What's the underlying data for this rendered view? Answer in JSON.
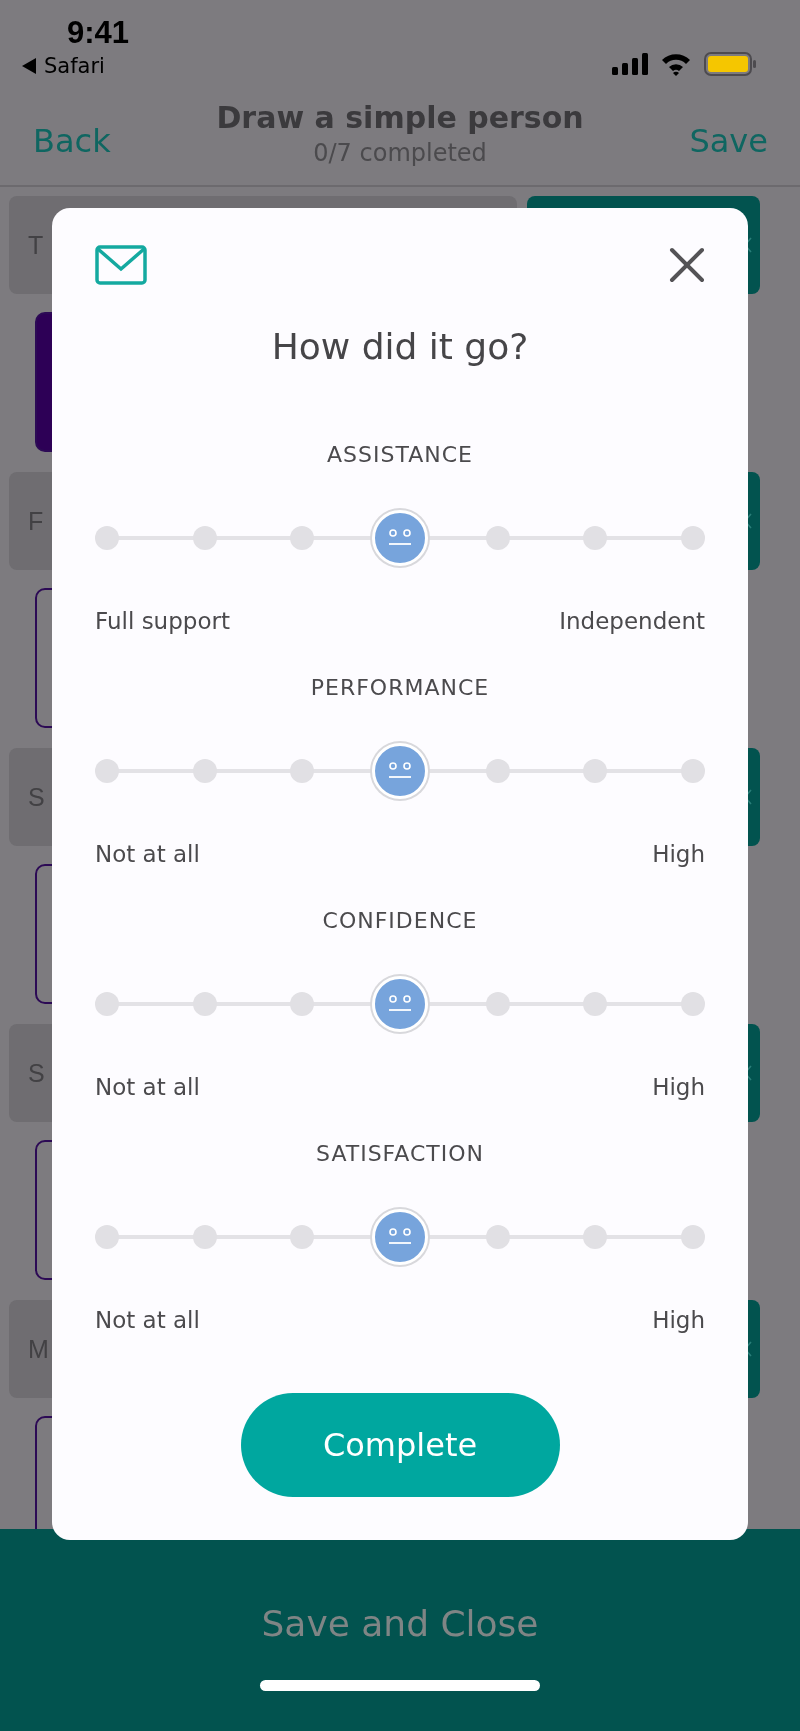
{
  "status_bar": {
    "time": "9:41",
    "back_app": "Safari"
  },
  "nav": {
    "back": "Back",
    "title": "Draw a simple person",
    "subtitle": "0/7 completed",
    "save": "Save"
  },
  "background_rows": [
    {
      "label": "T",
      "filled": true
    },
    {
      "label": "F",
      "filled": false
    },
    {
      "label": "S",
      "filled": false
    },
    {
      "label": "S",
      "filled": false
    },
    {
      "label": "M",
      "filled": false
    }
  ],
  "dialog": {
    "title": "How did it go?",
    "button": "Complete",
    "ratings": [
      {
        "label": "ASSISTANCE",
        "level": 0.5,
        "low": "Full support",
        "high": "Independent"
      },
      {
        "label": "PERFORMANCE",
        "level": 0.5,
        "low": "Not at all",
        "high": "High"
      },
      {
        "label": "CONFIDENCE",
        "level": 0.5,
        "low": "Not at all",
        "high": "High"
      },
      {
        "label": "SATISFACTION",
        "level": 0.5,
        "low": "Not at all",
        "high": "High"
      }
    ]
  },
  "footer_button": "Save and Close"
}
